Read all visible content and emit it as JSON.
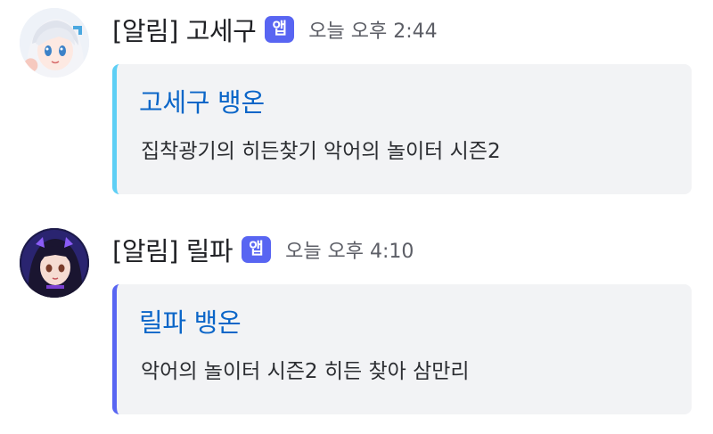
{
  "messages": [
    {
      "author": "[알림] 고세구",
      "badge": "앱",
      "timestamp": "오늘 오후 2:44",
      "embed": {
        "title": "고세구 뱅온",
        "description": "집착광기의 히든찾기 악어의 놀이터 시즌2",
        "accent_color": "#5ecff5"
      }
    },
    {
      "author": "[알림] 릴파",
      "badge": "앱",
      "timestamp": "오늘 오후 4:10",
      "embed": {
        "title": "릴파 뱅온",
        "description": "악어의 놀이터 시즌2 히든 찾아 삼만리",
        "accent_color": "#5865f2"
      }
    }
  ]
}
